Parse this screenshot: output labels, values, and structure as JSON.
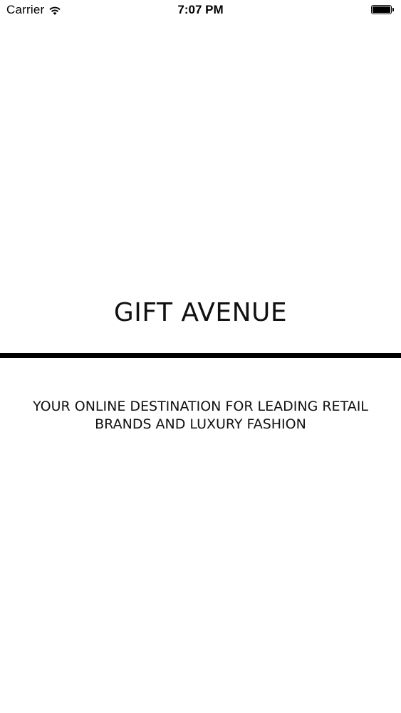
{
  "status_bar": {
    "carrier": "Carrier",
    "time": "7:07 PM",
    "wifi_icon": "wifi-icon",
    "battery_icon": "battery-icon",
    "battery_level": 1.0
  },
  "splash": {
    "title": "GIFT AVENUE",
    "tagline": "YOUR ONLINE DESTINATION FOR LEADING RETAIL BRANDS AND LUXURY FASHION"
  },
  "colors": {
    "background": "#ffffff",
    "text": "#000000",
    "divider": "#000000"
  }
}
